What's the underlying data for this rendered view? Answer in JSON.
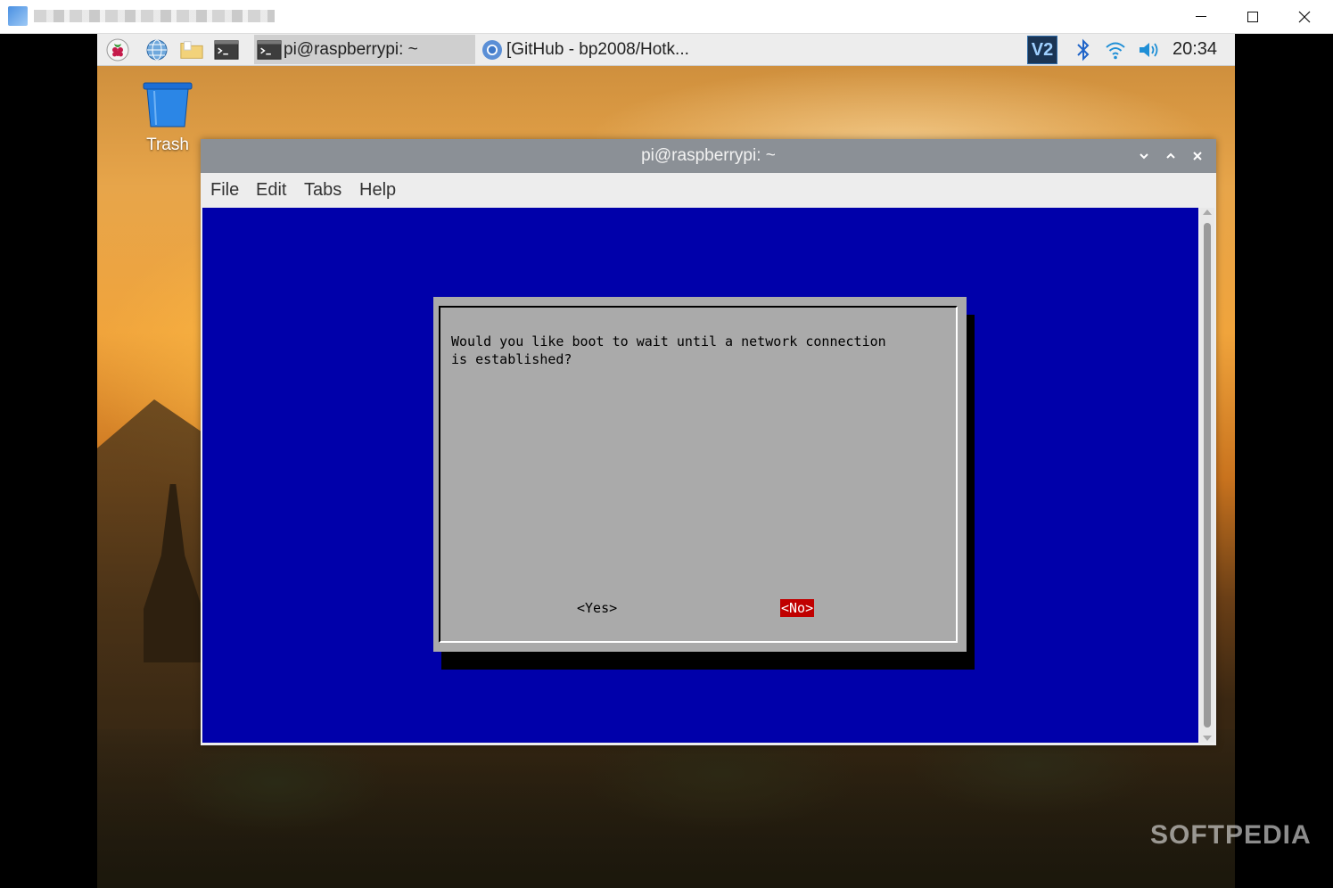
{
  "host_window": {
    "controls": {
      "minimize": "minimize",
      "maximize": "maximize",
      "close": "close"
    }
  },
  "taskbar": {
    "launchers": [
      {
        "icon": "raspberry-icon"
      },
      {
        "icon": "globe-icon"
      },
      {
        "icon": "folder-icon"
      },
      {
        "icon": "terminal-icon"
      }
    ],
    "tasks": [
      {
        "label": "pi@raspberrypi: ~",
        "icon": "terminal-icon"
      },
      {
        "label": "[GitHub - bp2008/Hotk...",
        "icon": "chromium-icon"
      }
    ],
    "tray": {
      "vnc_label": "V2",
      "clock": "20:34"
    }
  },
  "desktop": {
    "trash_label": "Trash"
  },
  "terminal": {
    "title": "pi@raspberrypi: ~",
    "menu": [
      "File",
      "Edit",
      "Tabs",
      "Help"
    ],
    "dialog": {
      "message": "Would you like boot to wait until a network connection\nis established?",
      "yes_label": "<Yes>",
      "no_label": "<No>"
    }
  },
  "watermark": "SOFTPEDIA",
  "colors": {
    "terminal_bg": "#0000aa",
    "dialog_bg": "#aaaaaa",
    "selected_button": "#c00000",
    "titlebar": "#8b9096"
  }
}
